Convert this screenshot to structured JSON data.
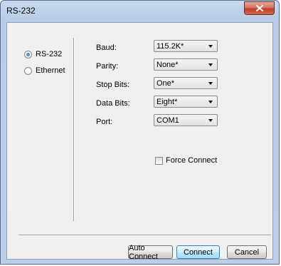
{
  "window": {
    "title": "RS-232"
  },
  "connection_type": {
    "options": [
      {
        "label": "RS-232",
        "selected": true
      },
      {
        "label": "Ethernet",
        "selected": false
      }
    ]
  },
  "settings": {
    "baud": {
      "label": "Baud:",
      "value": "115.2K*"
    },
    "parity": {
      "label": "Parity:",
      "value": "None*"
    },
    "stop_bits": {
      "label": "Stop Bits:",
      "value": "One*"
    },
    "data_bits": {
      "label": "Data Bits:",
      "value": "Eight*"
    },
    "port": {
      "label": "Port:",
      "value": "COM1"
    }
  },
  "force_connect": {
    "label": "Force Connect",
    "checked": false
  },
  "buttons": {
    "auto_connect": "Auto Connect",
    "connect": "Connect",
    "cancel": "Cancel"
  },
  "colors": {
    "close_button": "#c0402a",
    "radio_dot": "#1f5aa6",
    "default_button_border": "#3c7fb1"
  }
}
